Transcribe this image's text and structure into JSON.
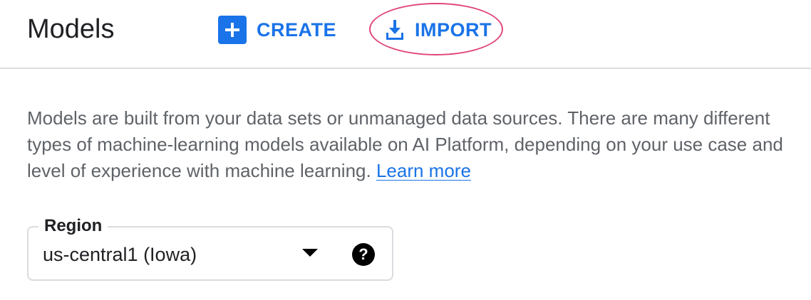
{
  "header": {
    "title": "Models",
    "actions": {
      "create_label": "CREATE",
      "import_label": "IMPORT"
    }
  },
  "description": {
    "text": "Models are built from your data sets or unmanaged data sources. There are many different types of machine-learning models available on AI Platform, depending on your use case and level of experience with machine learning.",
    "link_label": "Learn more"
  },
  "region": {
    "label": "Region",
    "value": "us-central1 (Iowa)",
    "help_glyph": "?"
  },
  "icons": {
    "create": "plus-icon",
    "import": "download-icon",
    "dropdown": "dropdown-arrow-icon",
    "help": "help-icon"
  },
  "colors": {
    "accent": "#1a73e8",
    "highlight": "#e0457b",
    "text_primary": "#202124",
    "text_secondary": "#5f6368",
    "border": "#dadce0"
  }
}
